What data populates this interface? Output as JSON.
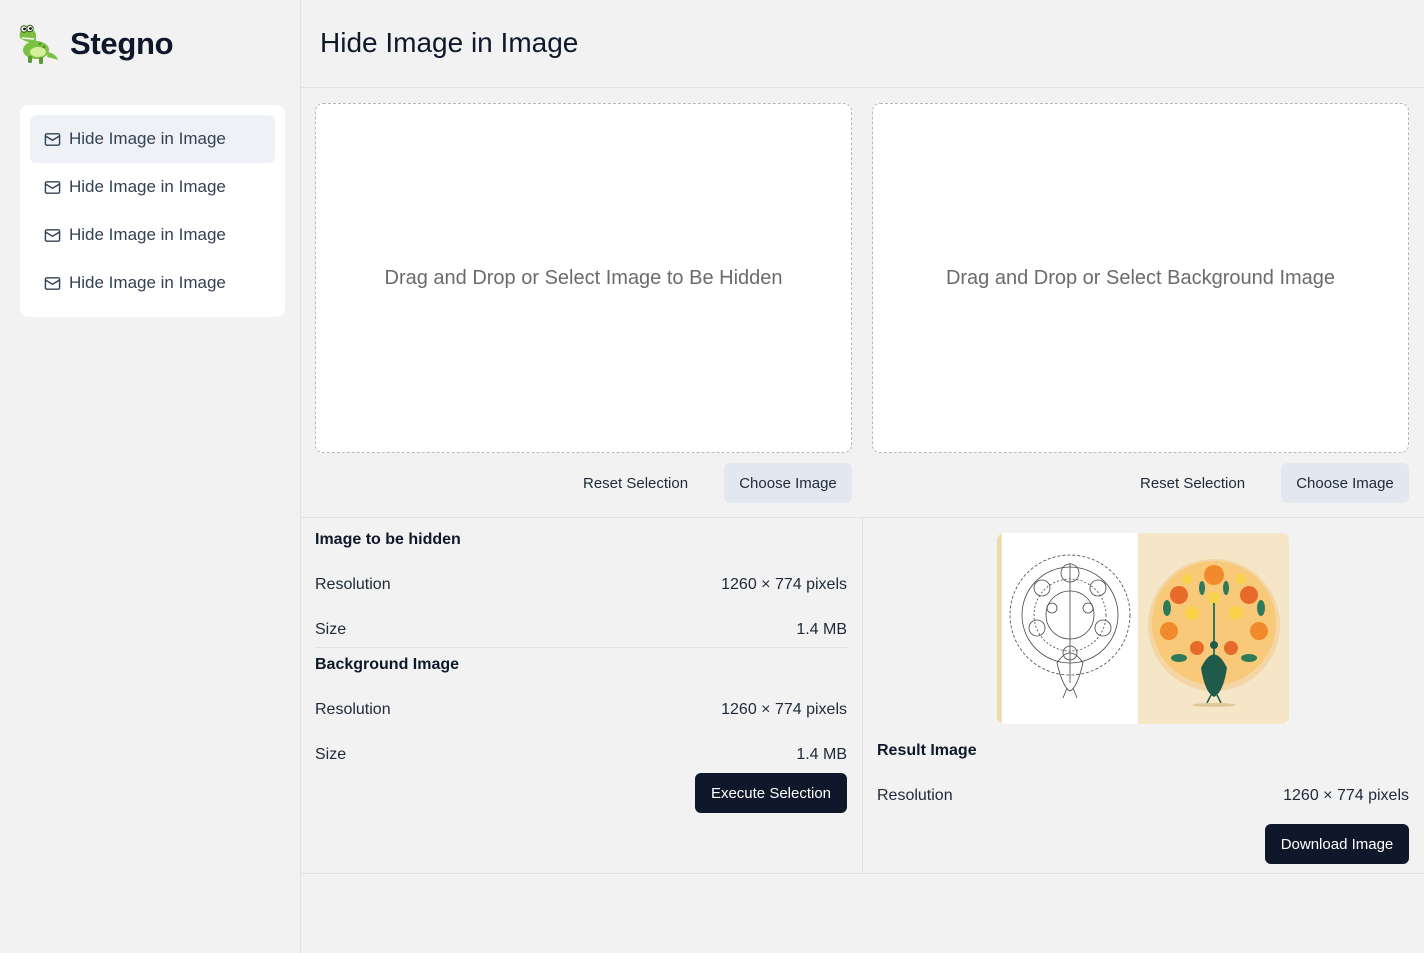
{
  "app": {
    "brand": "Stegno"
  },
  "sidebar": {
    "items": [
      {
        "label": "Hide Image in Image",
        "active": true
      },
      {
        "label": "Hide Image in Image",
        "active": false
      },
      {
        "label": "Hide Image in Image",
        "active": false
      },
      {
        "label": "Hide Image in Image",
        "active": false
      }
    ]
  },
  "main": {
    "title": "Hide Image in Image",
    "dropzones": {
      "hidden": {
        "text": "Drag and Drop or Select Image to Be Hidden",
        "reset_label": "Reset Selection",
        "choose_label": "Choose Image"
      },
      "background": {
        "text": "Drag and Drop or Select Background Image",
        "reset_label": "Reset Selection",
        "choose_label": "Choose Image"
      }
    },
    "hidden_info": {
      "heading": "Image to be hidden",
      "resolution_label": "Resolution",
      "resolution_value": "1260 × 774 pixels",
      "size_label": "Size",
      "size_value": "1.4 MB"
    },
    "background_info": {
      "heading": "Background Image",
      "resolution_label": "Resolution",
      "resolution_value": "1260 × 774 pixels",
      "size_label": "Size",
      "size_value": "1.4 MB"
    },
    "execute_label": "Execute Selection",
    "result": {
      "heading": "Result Image",
      "resolution_label": "Resolution",
      "resolution_value": "1260 × 774 pixels",
      "download_label": "Download Image"
    }
  },
  "icons": {
    "nav": "mail-icon",
    "logo": "crocodile-mascot-icon"
  },
  "colors": {
    "primary_dark": "#0f172a",
    "soft_button": "#e3e8f0",
    "active_nav": "#eef1f6"
  }
}
